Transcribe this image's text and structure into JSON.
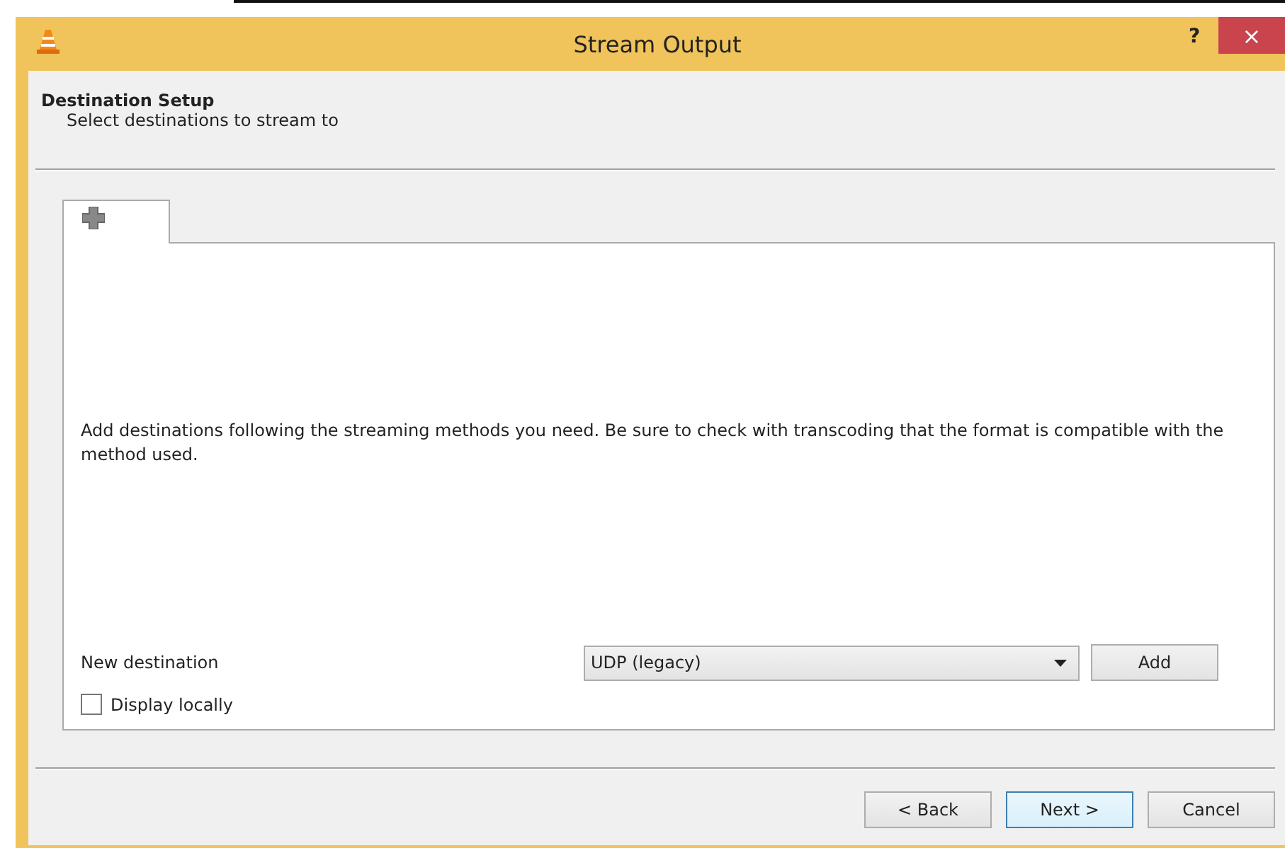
{
  "window": {
    "title": "Stream Output",
    "help": "?",
    "close": "×"
  },
  "header": {
    "title": "Destination Setup",
    "subtitle": "Select destinations to stream to"
  },
  "tabs": [
    {
      "kind": "add",
      "selected": true
    }
  ],
  "panel": {
    "description": "Add destinations following the streaming methods you need. Be sure to check with transcoding that the format is compatible with the method used.",
    "new_destination": {
      "label": "New destination",
      "value": "UDP (legacy)",
      "button": "Add"
    },
    "display_locally": {
      "label": "Display locally",
      "checked": false
    }
  },
  "buttons": [
    {
      "label": "< Back",
      "default": false
    },
    {
      "label": "Next >",
      "default": true
    },
    {
      "label": "Cancel",
      "default": false
    }
  ]
}
